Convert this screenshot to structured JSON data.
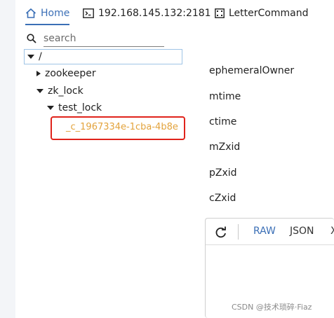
{
  "tabs": {
    "home": "Home",
    "connection": "192.168.145.132:2181",
    "letter_command": "LetterCommand"
  },
  "search": {
    "placeholder": "search"
  },
  "tree": {
    "root": "/",
    "nodes": [
      {
        "label": "zookeeper",
        "expanded": false
      },
      {
        "label": "zk_lock",
        "expanded": true
      },
      {
        "label": "test_lock",
        "expanded": true
      },
      {
        "label": "_c_1967334e-1cba-4b8e",
        "selected": true
      }
    ]
  },
  "properties": [
    "ephemeralOwner",
    "mtime",
    "ctime",
    "mZxid",
    "pZxid",
    "cZxid"
  ],
  "editor": {
    "raw": "RAW",
    "json": "JSON",
    "x": "X"
  },
  "watermark": "CSDN @技术琐碎·Fiaz",
  "colors": {
    "accent": "#3b6fb6",
    "selected_text": "#e3a33c",
    "highlight_box": "#e0231b"
  }
}
